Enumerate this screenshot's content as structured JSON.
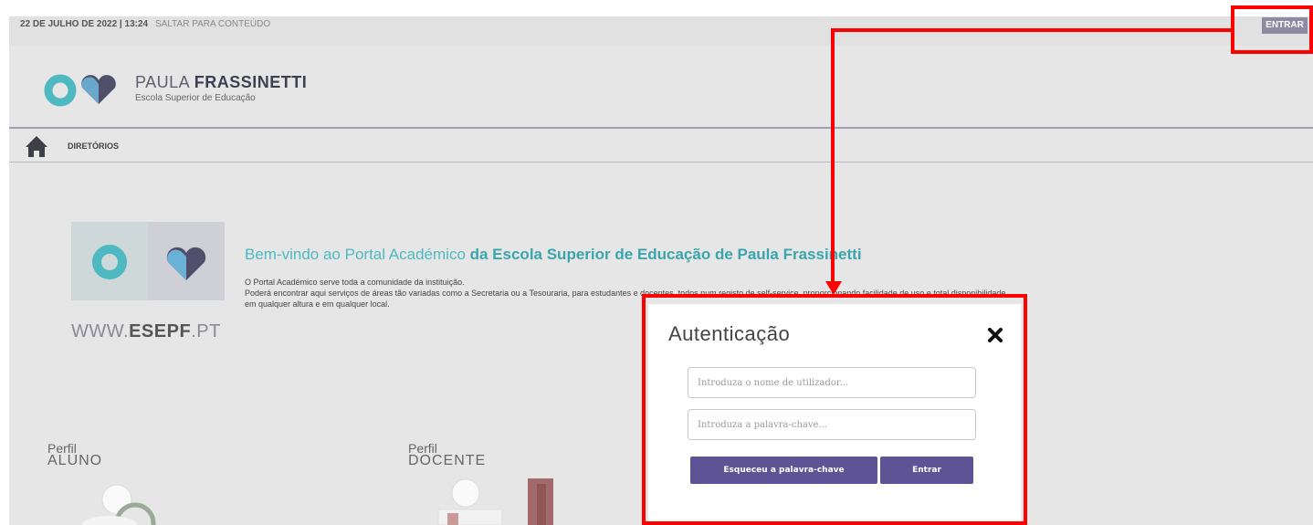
{
  "topbar": {
    "date": "22 DE JULHO DE 2022 | 13:24",
    "skip_link": "SALTAR PARA CONTEÚDO",
    "login_button": "ENTRAR"
  },
  "header": {
    "brand_light": "PAULA ",
    "brand_bold": "FRASSINETTI",
    "subtitle": "Escola Superior de Educação"
  },
  "nav": {
    "items": [
      {
        "label": "DIRETÓRIOS"
      }
    ]
  },
  "welcome": {
    "website_light": "WWW.",
    "website_bold": "ESEPF",
    "website_suffix": ".PT",
    "title_light": "Bem-vindo ao Portal Académico ",
    "title_bold": "da Escola Superior de Educação de Paula Frassinetti",
    "line1": "O Portal Académico serve toda a comunidade da instituição.",
    "line2": "Poderá encontrar aqui serviços de áreas tão variadas como a Secretaria ou a Tesouraria, para estudantes e docentes, todos num registo de self-service, proporcionando facilidade de uso e total disponibilidade",
    "line3": "em qualquer altura e em qualquer local."
  },
  "profiles": [
    {
      "prefix": "Perfil",
      "name": "ALUNO"
    },
    {
      "prefix": "Perfil",
      "name": "DOCENTE"
    }
  ],
  "modal": {
    "title": "Autenticação",
    "username_placeholder": "Introduza o nome de utilizador...",
    "password_placeholder": "Introduza a palavra-chave...",
    "forgot_button": "Esqueceu a palavra-chave",
    "submit_button": "Entrar"
  },
  "colors": {
    "accent_teal": "#4eb9c1",
    "brand_purple": "#5e5395",
    "annotation_red": "#ff0000"
  }
}
